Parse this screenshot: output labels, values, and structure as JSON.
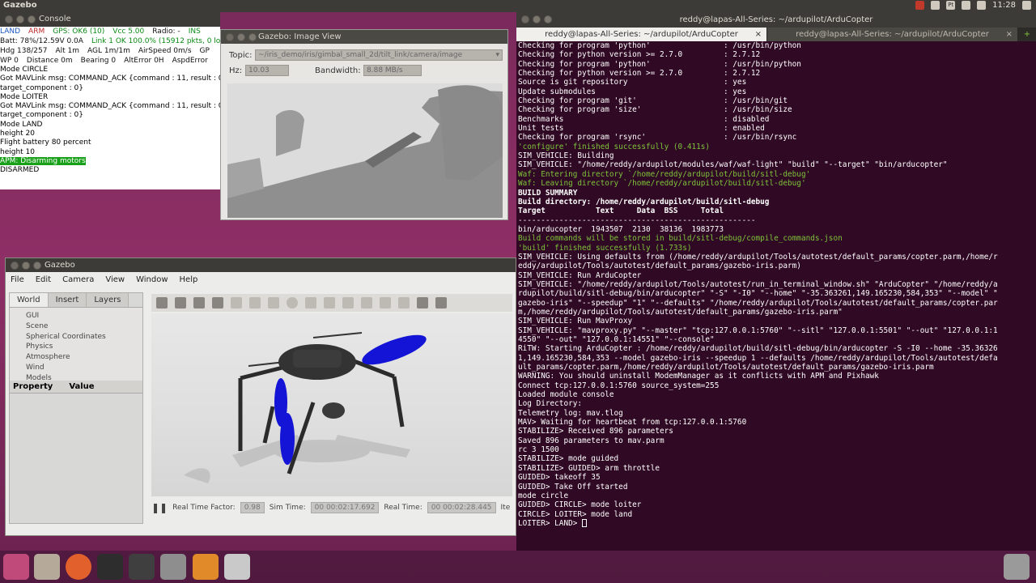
{
  "topbar": {
    "title": "Gazebo",
    "clock": "11:28",
    "tray": [
      "Pt"
    ]
  },
  "console": {
    "title": "Console",
    "status1": [
      {
        "t": "LAND",
        "c": "s-blue"
      },
      {
        "t": "ARM",
        "c": "s-red"
      },
      {
        "t": "GPS: OK6 (10)",
        "c": "s-green"
      },
      {
        "t": "Vcc 5.00",
        "c": "s-green"
      },
      {
        "t": "Radio: -",
        "c": "s-black"
      },
      {
        "t": "INS",
        "c": "s-green"
      }
    ],
    "status2": [
      {
        "t": "Batt: 78%/12.59V 0.0A",
        "c": "s-black"
      },
      {
        "t": "Link 1 OK 100.0% (15912 pkts, 0 los",
        "c": "s-green"
      }
    ],
    "status3": [
      "Hdg 138/257",
      "Alt 1m",
      "AGL 1m/1m",
      "AirSpeed 0m/s",
      "GP"
    ],
    "status4": [
      "WP 0",
      "Distance 0m",
      "Bearing 0",
      "AltError 0H",
      "AspdError"
    ],
    "log": [
      "Mode CIRCLE",
      "Got MAVLink msg: COMMAND_ACK {command : 11, result : 0,",
      "target_component : 0}",
      "Mode LOITER",
      "Got MAVLink msg: COMMAND_ACK {command : 11, result : 0,",
      "target_component : 0}",
      "Mode LAND",
      "height 20",
      "Flight battery 80 percent",
      "height 10"
    ],
    "highlight": "APM: Disarming motors",
    "last": "DISARMED"
  },
  "imageview": {
    "title": "Gazebo: Image View",
    "topic_label": "Topic:",
    "topic_value": "~/iris_demo/iris/gimbal_small_2d/tilt_link/camera/image",
    "hz_label": "Hz:",
    "hz_value": "10.03",
    "bw_label": "Bandwidth:",
    "bw_value": "8.88 MB/s"
  },
  "gazebo": {
    "title": "Gazebo",
    "menu": [
      "File",
      "Edit",
      "Camera",
      "View",
      "Window",
      "Help"
    ],
    "tabs": [
      "World",
      "Insert",
      "Layers"
    ],
    "tree": [
      "GUI",
      "Scene",
      "Spherical Coordinates",
      "Physics",
      "Atmosphere",
      "Wind",
      "Models"
    ],
    "prop_headers": [
      "Property",
      "Value"
    ],
    "rtf_label": "Real Time Factor:",
    "rtf_value": "0.98",
    "sim_label": "Sim Time:",
    "sim_value": "00 00:02:17.692",
    "real_label": "Real Time:",
    "real_value": "00 00:02:28.445",
    "iter_label": "Ite"
  },
  "terminal": {
    "title": "reddy@lapas-All-Series: ~/ardupilot/ArduCopter",
    "tabs": [
      "reddy@lapas-All-Series: ~/ardupilot/ArduCopter",
      "reddy@lapas-All-Series: ~/ardupilot/ArduCopter"
    ],
    "lines": [
      {
        "t": "Checking for program 'python'                : /usr/bin/python",
        "c": ""
      },
      {
        "t": "Checking for python version >= 2.7.0         : 2.7.12",
        "c": ""
      },
      {
        "t": "Checking for program 'python'                : /usr/bin/python",
        "c": ""
      },
      {
        "t": "Checking for python version >= 2.7.0         : 2.7.12",
        "c": ""
      },
      {
        "t": "Source is git repository                     : yes",
        "c": ""
      },
      {
        "t": "Update submodules                            : yes",
        "c": ""
      },
      {
        "t": "Checking for program 'git'                   : /usr/bin/git",
        "c": ""
      },
      {
        "t": "Checking for program 'size'                  : /usr/bin/size",
        "c": ""
      },
      {
        "t": "Benchmarks                                   : disabled",
        "c": ""
      },
      {
        "t": "Unit tests                                   : enabled",
        "c": ""
      },
      {
        "t": "Checking for program 'rsync'                 : /usr/bin/rsync",
        "c": ""
      },
      {
        "t": "'configure' finished successfully (0.411s)",
        "c": "g"
      },
      {
        "t": "SIM_VEHICLE: Building",
        "c": ""
      },
      {
        "t": "SIM_VEHICLE: \"/home/reddy/ardupilot/modules/waf/waf-light\" \"build\" \"--target\" \"bin/arducopter\"",
        "c": ""
      },
      {
        "t": "Waf: Entering directory `/home/reddy/ardupilot/build/sitl-debug'",
        "c": "g"
      },
      {
        "t": "Waf: Leaving directory `/home/reddy/ardupilot/build/sitl-debug'",
        "c": "g"
      },
      {
        "t": "",
        "c": ""
      },
      {
        "t": "BUILD SUMMARY",
        "c": "b"
      },
      {
        "t": "Build directory: /home/reddy/ardupilot/build/sitl-debug",
        "c": "b"
      },
      {
        "t": "Target           Text     Data  BSS     Total",
        "c": "b"
      },
      {
        "t": "----------------------------------------------------",
        "c": ""
      },
      {
        "t": "bin/arducopter  1943507  2130  38136  1983773",
        "c": ""
      },
      {
        "t": "",
        "c": ""
      },
      {
        "t": "Build commands will be stored in build/sitl-debug/compile_commands.json",
        "c": "g"
      },
      {
        "t": "'build' finished successfully (1.733s)",
        "c": "g"
      },
      {
        "t": "SIM_VEHICLE: Using defaults from (/home/reddy/ardupilot/Tools/autotest/default_params/copter.parm,/home/r",
        "c": ""
      },
      {
        "t": "eddy/ardupilot/Tools/autotest/default_params/gazebo-iris.parm)",
        "c": ""
      },
      {
        "t": "SIM_VEHICLE: Run ArduCopter",
        "c": ""
      },
      {
        "t": "SIM_VEHICLE: \"/home/reddy/ardupilot/Tools/autotest/run_in_terminal_window.sh\" \"ArduCopter\" \"/home/reddy/a",
        "c": ""
      },
      {
        "t": "rdupilot/build/sitl-debug/bin/arducopter\" \"-S\" \"-I0\" \"--home\" \"-35.363261,149.165230,584,353\" \"--model\" \"",
        "c": ""
      },
      {
        "t": "gazebo-iris\" \"--speedup\" \"1\" \"--defaults\" \"/home/reddy/ardupilot/Tools/autotest/default_params/copter.par",
        "c": ""
      },
      {
        "t": "m,/home/reddy/ardupilot/Tools/autotest/default_params/gazebo-iris.parm\"",
        "c": ""
      },
      {
        "t": "SIM_VEHICLE: Run MavProxy",
        "c": ""
      },
      {
        "t": "SIM_VEHICLE: \"mavproxy.py\" \"--master\" \"tcp:127.0.0.1:5760\" \"--sitl\" \"127.0.0.1:5501\" \"--out\" \"127.0.0.1:1",
        "c": ""
      },
      {
        "t": "4550\" \"--out\" \"127.0.0.1:14551\" \"--console\"",
        "c": ""
      },
      {
        "t": "RiTW: Starting ArduCopter : /home/reddy/ardupilot/build/sitl-debug/bin/arducopter -S -I0 --home -35.36326",
        "c": ""
      },
      {
        "t": "1,149.165230,584,353 --model gazebo-iris --speedup 1 --defaults /home/reddy/ardupilot/Tools/autotest/defa",
        "c": ""
      },
      {
        "t": "ult_params/copter.parm,/home/reddy/ardupilot/Tools/autotest/default_params/gazebo-iris.parm",
        "c": ""
      },
      {
        "t": "WARNING: You should uninstall ModemManager as it conflicts with APM and Pixhawk",
        "c": ""
      },
      {
        "t": "Connect tcp:127.0.0.1:5760 source_system=255",
        "c": ""
      },
      {
        "t": "Loaded module console",
        "c": ""
      },
      {
        "t": "Log Directory:",
        "c": ""
      },
      {
        "t": "Telemetry log: mav.tlog",
        "c": ""
      },
      {
        "t": "MAV> Waiting for heartbeat from tcp:127.0.0.1:5760",
        "c": ""
      },
      {
        "t": "STABILIZE> Received 896 parameters",
        "c": ""
      },
      {
        "t": "Saved 896 parameters to mav.parm",
        "c": ""
      },
      {
        "t": "rc 3 1500",
        "c": ""
      },
      {
        "t": "STABILIZE> mode guided",
        "c": ""
      },
      {
        "t": "STABILIZE> GUIDED> arm throttle",
        "c": ""
      },
      {
        "t": "GUIDED> takeoff 35",
        "c": ""
      },
      {
        "t": "GUIDED> Take Off started",
        "c": ""
      },
      {
        "t": "mode circle",
        "c": ""
      },
      {
        "t": "GUIDED> CIRCLE> mode loiter",
        "c": ""
      },
      {
        "t": "CIRCLE> LOITER> mode land",
        "c": ""
      },
      {
        "t": "LOITER> LAND> ",
        "c": ""
      }
    ]
  }
}
